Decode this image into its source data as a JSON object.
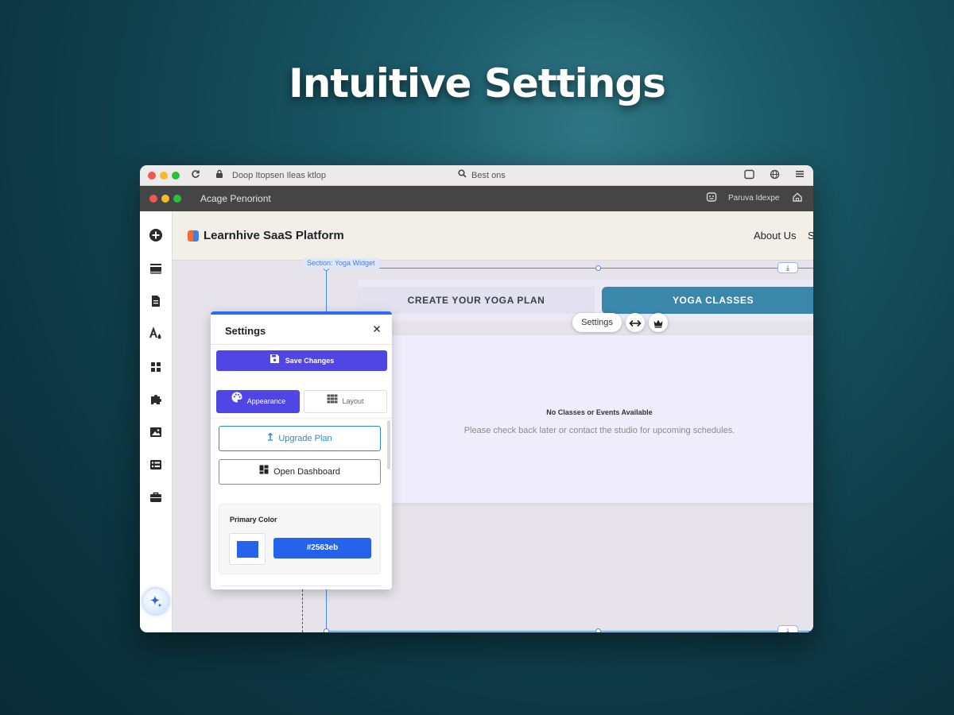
{
  "headline": "Intuitive Settings",
  "colors": {
    "accent": "#5046e5",
    "primary_swatch": "#2563eb",
    "tab_active": "#3b86ab",
    "link_blue": "#2b8ad8"
  },
  "browser": {
    "address_text": "Doop Itopsen Ileas ktlop",
    "search_text": "Best ons",
    "icons": [
      "reload-icon",
      "lock-icon",
      "search-icon",
      "window-icon",
      "globe-icon",
      "menu-icon"
    ]
  },
  "app_bar": {
    "title": "Acage Penoriont",
    "right_text": "Paruva Idexpe"
  },
  "left_rail": {
    "icons": [
      "add-icon",
      "layout-icon",
      "page-icon",
      "theme-icon",
      "apps-icon",
      "puzzle-icon",
      "image-icon",
      "list-icon",
      "briefcase-icon",
      "ai-sparkle-icon"
    ]
  },
  "site": {
    "brand": "Learnhive SaaS Platform",
    "nav_about": "About Us",
    "nav_cut": "S",
    "section_tag": "Section: Yoga Widget",
    "tabs": [
      "CREATE YOUR YOGA PLAN",
      "YOGA CLASSES"
    ],
    "active_tab": "YOGA CLASSES",
    "floating_settings": "Settings",
    "empty_title": "No Classes or Events Available",
    "empty_sub": "Please check back later or contact the studio for upcoming schedules."
  },
  "settings_panel": {
    "title": "Settings",
    "save_label": "Save Changes",
    "tab_appearance": "Appearance",
    "tab_layout": "Layout",
    "active_tab": "Appearance",
    "upgrade_label": "Upgrade Plan",
    "dashboard_label": "Open Dashboard",
    "primary_color_label": "Primary Color",
    "primary_color_value": "#2563eb"
  }
}
